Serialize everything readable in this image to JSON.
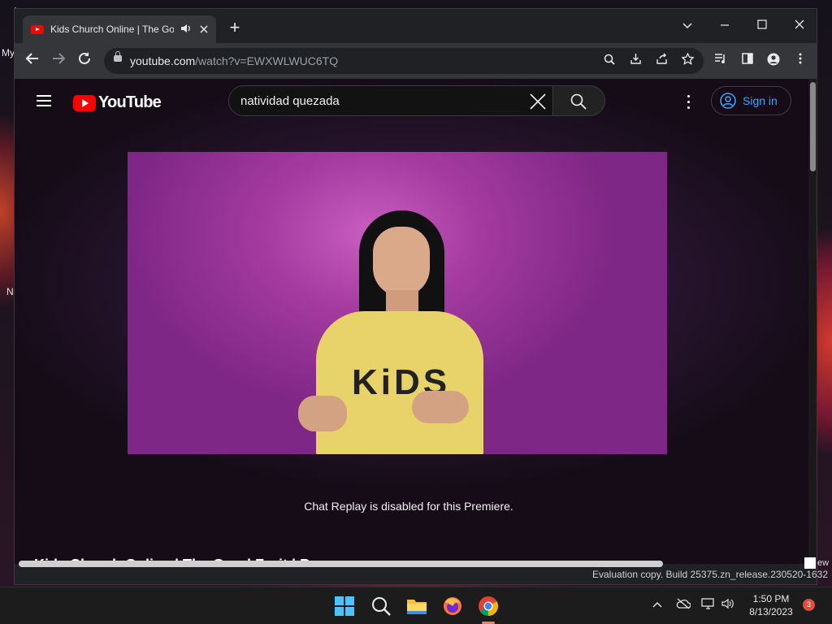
{
  "desktop": {
    "label_my": "My",
    "label_n": "N",
    "label_ew": "ew",
    "eval_text": "Evaluation copy. Build 25375.zn_release.230520-1632"
  },
  "browser": {
    "tab_title": "Kids Church Online | The Goo",
    "new_tab": "+",
    "url_host": "youtube.com",
    "url_path": "/watch?v=EWXWLWUC6TQ"
  },
  "youtube": {
    "logo_text": "YouTube",
    "search_value": "natividad quezada",
    "sign_in_label": "Sign in",
    "chat_replay_text": "Chat Replay is disabled for this Premiere.",
    "video_title_peek": "Kids Church Online | The Good Fruit | P",
    "shirt_print": "KiDS"
  },
  "taskbar": {
    "time": "1:50 PM",
    "date": "8/13/2023",
    "notification_count": "3"
  },
  "colors": {
    "yt_red": "#ff0000",
    "signin_blue": "#3ea6ff",
    "video_bg": "#a43aa0"
  }
}
